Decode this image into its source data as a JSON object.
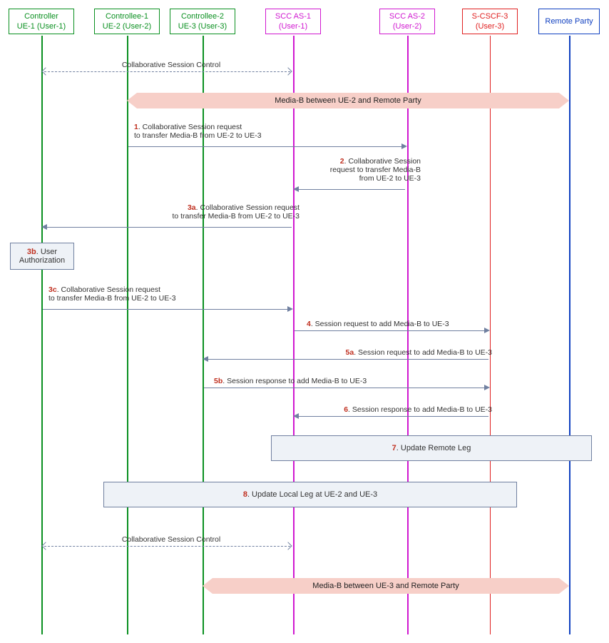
{
  "actors": {
    "ue1": "Controller\nUE-1 (User-1)",
    "ue2": "Controllee-1\nUE-2 (User-2)",
    "ue3": "Controllee-2\nUE-3 (User-3)",
    "scc1": "SCC AS-1\n(User-1)",
    "scc2": "SCC AS-2\n(User-2)",
    "scscf3": "S-CSCF-3\n(User-3)",
    "remote": "Remote Party"
  },
  "labels": {
    "collab_control": "Collaborative Session Control",
    "media_b_ue2": "Media-B between UE-2 and Remote Party",
    "media_b_ue3": "Media-B between UE-3 and Remote Party"
  },
  "steps": {
    "s1_num": "1",
    "s1_txt": ". Collaborative Session request\nto transfer Media-B from UE-2 to UE-3",
    "s2_num": "2",
    "s2_txt": ". Collaborative Session\nrequest to transfer Media-B\nfrom UE-2 to UE-3",
    "s3a_num": "3a",
    "s3a_txt": ". Collaborative Session request\nto transfer Media-B from UE-2 to UE-3",
    "s3b_num": "3b",
    "s3b_txt": ". User\nAuthorization",
    "s3c_num": "3c",
    "s3c_txt": ". Collaborative Session request\nto transfer Media-B from UE-2 to UE-3",
    "s4_num": "4",
    "s4_txt": ". Session request to add Media-B to  UE-3",
    "s5a_num": "5a",
    "s5a_txt": ". Session request to add Media-B to  UE-3",
    "s5b_num": "5b",
    "s5b_txt": ". Session response to add Media-B to  UE-3",
    "s6_num": "6",
    "s6_txt": ". Session response to add Media-B to  UE-3",
    "s7_num": "7",
    "s7_txt": ". Update Remote Leg",
    "s8_num": "8",
    "s8_txt": ". Update Local Leg at UE-2 and UE-3"
  }
}
